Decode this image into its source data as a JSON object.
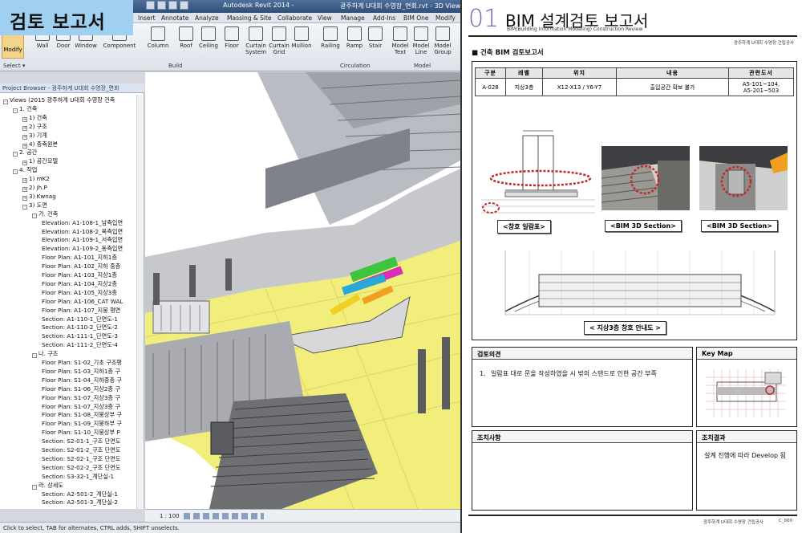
{
  "overlay_title": "검토 보고서",
  "revit": {
    "window_title": "Autodesk Revit 2014 -",
    "window_title_doc": "광주하계 U대회 수영장_면회.rvt - 3D View:",
    "menu": [
      "Insert",
      "Annotate",
      "Analyze",
      "Massing & Site",
      "Collaborate",
      "View",
      "Manage",
      "Add-Ins",
      "BIM One",
      "Modify"
    ],
    "modify_label": "Modify",
    "select_label": "Select ▾",
    "build_group": "Build",
    "circulation_group": "Circulation",
    "model_group": "Model",
    "tools": [
      {
        "name": "wall",
        "label": "Wall"
      },
      {
        "name": "door",
        "label": "Door"
      },
      {
        "name": "window",
        "label": "Window"
      },
      {
        "name": "component",
        "label": "Component"
      },
      {
        "name": "column",
        "label": "Column"
      },
      {
        "name": "roof",
        "label": "Roof"
      },
      {
        "name": "ceiling",
        "label": "Ceiling"
      },
      {
        "name": "floor",
        "label": "Floor"
      },
      {
        "name": "curtain-system",
        "label": "Curtain System"
      },
      {
        "name": "curtain-grid",
        "label": "Curtain Grid"
      },
      {
        "name": "mullion",
        "label": "Mullion"
      },
      {
        "name": "railing",
        "label": "Railing"
      },
      {
        "name": "ramp",
        "label": "Ramp"
      },
      {
        "name": "stair",
        "label": "Stair"
      },
      {
        "name": "model-text",
        "label": "Model Text"
      },
      {
        "name": "model-line",
        "label": "Model Line"
      },
      {
        "name": "model-group",
        "label": "Model Group"
      }
    ],
    "project_browser_title": "Project Browser - 광주하계 U대회 수영장_면회",
    "tree": [
      {
        "t": "Views (2015 광주하계 U대회 수영장 건축",
        "d": 0,
        "b": "-"
      },
      {
        "t": "1. 건축",
        "d": 1,
        "b": "-"
      },
      {
        "t": "1) 건축",
        "d": 2,
        "b": "+"
      },
      {
        "t": "2) 구조",
        "d": 2,
        "b": "+"
      },
      {
        "t": "3) 기계",
        "d": 2,
        "b": "+"
      },
      {
        "t": "4) 종축원본",
        "d": 2,
        "b": "+"
      },
      {
        "t": "2. 공간",
        "d": 1,
        "b": "-"
      },
      {
        "t": "1) 공간모델",
        "d": 2,
        "b": "+"
      },
      {
        "t": "4. 작업",
        "d": 1,
        "b": "-"
      },
      {
        "t": "1) mK2",
        "d": 2,
        "b": "+"
      },
      {
        "t": "2) jh.P",
        "d": 2,
        "b": "+"
      },
      {
        "t": "3) Kwnag",
        "d": 2,
        "b": "+"
      },
      {
        "t": "3) 도면",
        "d": 2,
        "b": "-"
      },
      {
        "t": "가. 건축",
        "d": 3,
        "b": "-"
      },
      {
        "t": "Elevation: A1-108-1_남측입면",
        "d": 4,
        "b": ""
      },
      {
        "t": "Elevation: A1-108-2_북측입면",
        "d": 4,
        "b": ""
      },
      {
        "t": "Elevation: A1-109-1_서측입면",
        "d": 4,
        "b": ""
      },
      {
        "t": "Elevation: A1-109-2_동측입면",
        "d": 4,
        "b": ""
      },
      {
        "t": "Floor Plan: A1-101_지하1층",
        "d": 4,
        "b": ""
      },
      {
        "t": "Floor Plan: A1-102_지하 중층",
        "d": 4,
        "b": ""
      },
      {
        "t": "Floor Plan: A1-103_지상1층",
        "d": 4,
        "b": ""
      },
      {
        "t": "Floor Plan: A1-104_지상2층",
        "d": 4,
        "b": ""
      },
      {
        "t": "Floor Plan: A1-105_지상3층",
        "d": 4,
        "b": ""
      },
      {
        "t": "Floor Plan: A1-106_CAT WAL",
        "d": 4,
        "b": ""
      },
      {
        "t": "Floor Plan: A1-107_지붕 평면",
        "d": 4,
        "b": ""
      },
      {
        "t": "Section: A1-110-1_단면도-1",
        "d": 4,
        "b": ""
      },
      {
        "t": "Section: A1-110-2_단면도-2",
        "d": 4,
        "b": ""
      },
      {
        "t": "Section: A1-111-1_단면도-3",
        "d": 4,
        "b": ""
      },
      {
        "t": "Section: A1-111-2_단면도-4",
        "d": 4,
        "b": ""
      },
      {
        "t": "나. 구조",
        "d": 3,
        "b": "-"
      },
      {
        "t": "Floor Plan: S1-02_기초 구조평",
        "d": 4,
        "b": ""
      },
      {
        "t": "Floor Plan: S1-03_지하1층 구",
        "d": 4,
        "b": ""
      },
      {
        "t": "Floor Plan: S1-04_지하중층 구",
        "d": 4,
        "b": ""
      },
      {
        "t": "Floor Plan: S1-06_지상2층 구",
        "d": 4,
        "b": ""
      },
      {
        "t": "Floor Plan: S1-07_지상3층 구",
        "d": 4,
        "b": ""
      },
      {
        "t": "Floor Plan: S1-07_지상3층 구",
        "d": 4,
        "b": ""
      },
      {
        "t": "Floor Plan: S1-08_지붕상부 구",
        "d": 4,
        "b": ""
      },
      {
        "t": "Floor Plan: S1-09_지붕하부 구",
        "d": 4,
        "b": ""
      },
      {
        "t": "Floor Plan: S1-10_지붕상부 P",
        "d": 4,
        "b": ""
      },
      {
        "t": "Section: S2-01-1_구조 단면도",
        "d": 4,
        "b": ""
      },
      {
        "t": "Section: S2-01-2_구조 단면도",
        "d": 4,
        "b": ""
      },
      {
        "t": "Section: S2-02-1_구조 단면도",
        "d": 4,
        "b": ""
      },
      {
        "t": "Section: S2-02-2_구조 단면도",
        "d": 4,
        "b": ""
      },
      {
        "t": "Section: S3-32-1_계단실-1",
        "d": 4,
        "b": ""
      },
      {
        "t": "라. 상세도",
        "d": 3,
        "b": "-"
      },
      {
        "t": "Section: A2-501-2_계단실-1",
        "d": 4,
        "b": ""
      },
      {
        "t": "Section: A2-501-3_계단실-2",
        "d": 4,
        "b": ""
      }
    ],
    "scale": "1 : 100",
    "status": "Click to select, TAB for alternates, CTRL adds, SHIFT unselects."
  },
  "report": {
    "num": "01",
    "title": "BIM 설계검토 보고서",
    "subtitle": "BIM(Building Information Modeling) Construction Review",
    "corner": "광주하계 U대회 수영장 건립공사",
    "section": "■ 건축 BIM 검토보고서",
    "table_headers": [
      "구분",
      "레벨",
      "위치",
      "내용",
      "관련도서"
    ],
    "table_row": [
      "A-028",
      "지상3층",
      "X12-X13 / Y6-Y7",
      "출입공간 확보 불가",
      "A5-101~104,\nA5-201~503"
    ],
    "captions": [
      "<창호 일람표>",
      "<BIM 3D Section>",
      "<BIM 3D Section>",
      "< 지상3층 창호 안내도 >"
    ],
    "review_head": "검토의견",
    "review_item_no": "1.",
    "review_item": "일람표 대로 문을 작성하였을 시 밖의 스탠드로 인한 공간 부족",
    "action_head": "조치사항",
    "keymap_head": "Key Map",
    "result_head": "조치결과",
    "result_text": "설계 진행에 따라 Develop 됨",
    "footer": "광주하계 U대회 수영장 건립공사",
    "footer_page": "C_000"
  },
  "colors": {
    "overlay_bg": "#9fd0ef",
    "report_num": "#6b6bb8",
    "slab_yellow": "#f2ee7c",
    "highlight_red": "#c62828"
  }
}
